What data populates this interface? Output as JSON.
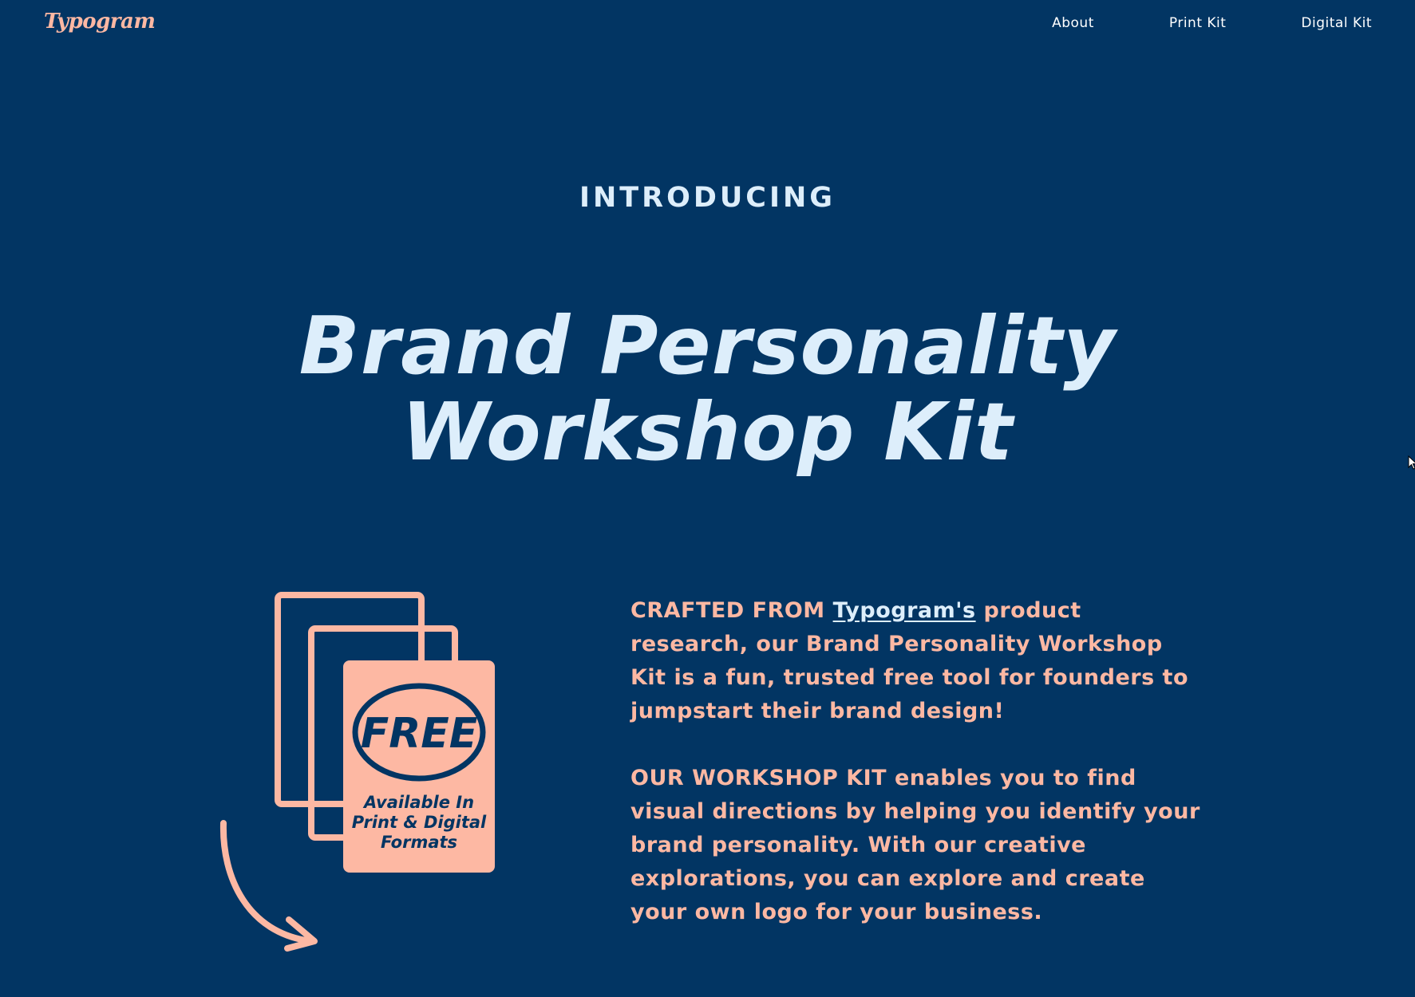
{
  "header": {
    "logo": "Typogram",
    "nav": [
      {
        "label": "About"
      },
      {
        "label": "Print Kit"
      },
      {
        "label": "Digital Kit"
      }
    ]
  },
  "hero": {
    "eyebrow": "INTRODUCING",
    "title_line1": "Brand Personality",
    "title_line2": "Workshop Kit"
  },
  "illustration": {
    "badge": "FREE",
    "caption_line1": "Available In",
    "caption_line2": "Print & Digital",
    "caption_line3": "Formats",
    "icons": [
      "document-stack-icon",
      "curved-arrow-icon"
    ]
  },
  "description": {
    "p1_lead": "CRAFTED FROM ",
    "p1_link": "Typogram's",
    "p1_rest": " product research, our Brand Personality Workshop Kit is a fun, trusted free tool for founders to jumpstart their brand design!",
    "p2": "OUR WORKSHOP KIT enables you to find visual directions by helping you identify your brand personality. With our creative explorations, you can explore and create your own logo for your business."
  },
  "colors": {
    "background": "#023563",
    "accent": "#FDB8A3",
    "headline": "#DDEEFB"
  }
}
